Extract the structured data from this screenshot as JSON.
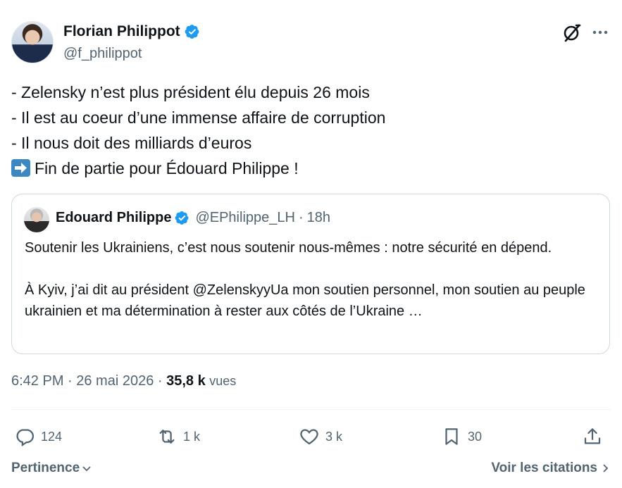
{
  "author": {
    "name": "Florian Philippot",
    "handle": "@f_philippot",
    "verified_color": "#1d9bf0"
  },
  "tweet": {
    "lines": [
      "- Zelensky n’est plus président élu depuis 26 mois",
      "- Il est au coeur d’une immense affaire de corruption",
      "- Il nous doit des milliards d’euros",
      "Fin de partie pour Édouard Philippe !"
    ],
    "emoji": "right-arrow-emoji"
  },
  "quote": {
    "name": "Edouard Philippe",
    "handle": "@EPhilippe_LH",
    "separator": "·",
    "time": "18h",
    "paragraph1": "Soutenir les Ukrainiens, c’est nous soutenir nous-mêmes : notre sécurité en dépend.",
    "paragraph2": "À Kyiv, j’ai dit au président @ZelenskyyUa mon soutien personnel, mon soutien au peuple ukrainien et ma détermination à rester aux côtés de l’Ukraine …"
  },
  "meta": {
    "time_date": "6:42 PM · 26 mai 2026 · ",
    "views_count": "35,8 k",
    "views_label": "vues"
  },
  "actions": {
    "replies": "124",
    "reposts": "1 k",
    "likes": "3 k",
    "bookmarks": "30"
  },
  "footer": {
    "sort_label": "Pertinence",
    "citations_label": "Voir les citations"
  },
  "colors": {
    "text": "#0f1419",
    "secondary": "#536471",
    "border": "#cfd9de",
    "verified": "#1d9bf0"
  }
}
